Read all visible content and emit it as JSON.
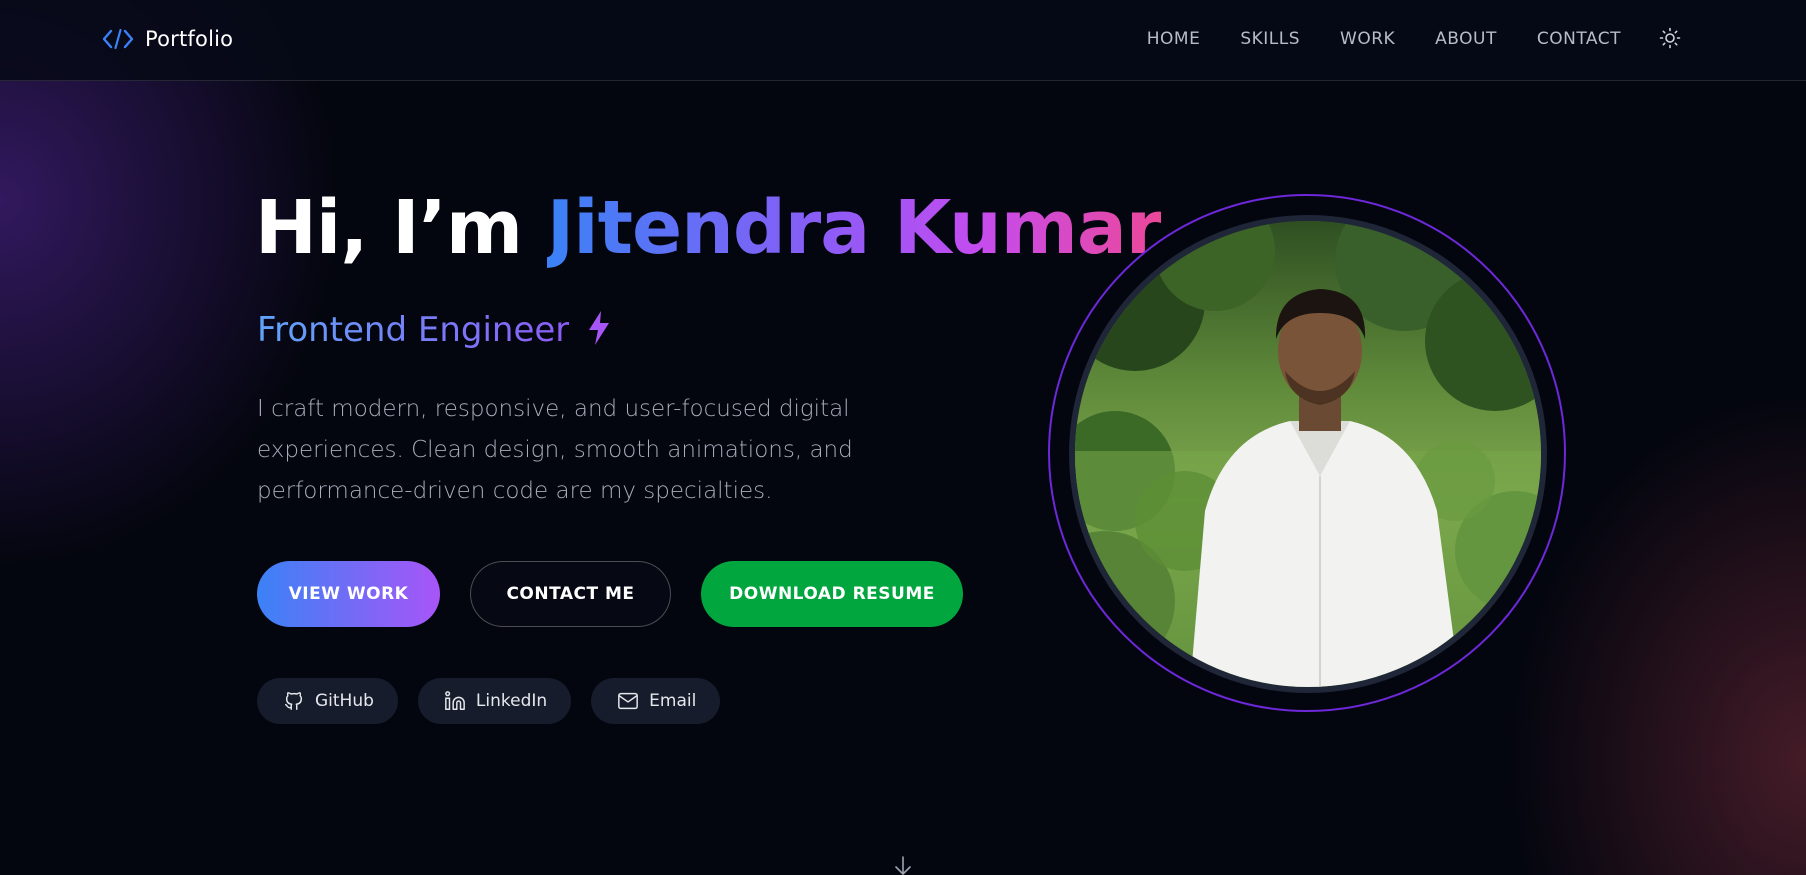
{
  "navbar": {
    "brand": "Portfolio",
    "brand_icon": "code-brackets-icon",
    "links": [
      "HOME",
      "SKILLS",
      "WORK",
      "ABOUT",
      "CONTACT"
    ],
    "theme_icon": "sun-icon"
  },
  "hero": {
    "greeting": "Hi, I’m ",
    "name": "Jitendra Kumar",
    "role": "Frontend Engineer",
    "role_icon": "lightning-bolt-icon",
    "description": "I craft modern, responsive, and user-focused digital experiences. Clean design, smooth animations, and performance-driven code are my specialties.",
    "buttons": {
      "view_work": "VIEW WORK",
      "contact_me": "CONTACT ME",
      "download_resume": "DOWNLOAD RESUME"
    },
    "socials": [
      {
        "label": "GitHub",
        "icon": "github-icon"
      },
      {
        "label": "LinkedIn",
        "icon": "linkedin-icon"
      },
      {
        "label": "Email",
        "icon": "mail-icon"
      }
    ],
    "scroll_icon": "arrow-down-icon"
  },
  "colors": {
    "background": "#04060f",
    "accent_blue": "#3b82f6",
    "accent_purple": "#a855f7",
    "accent_pink": "#ec4899",
    "resume_green": "#01a63e",
    "ring_purple": "#6d28d9"
  }
}
